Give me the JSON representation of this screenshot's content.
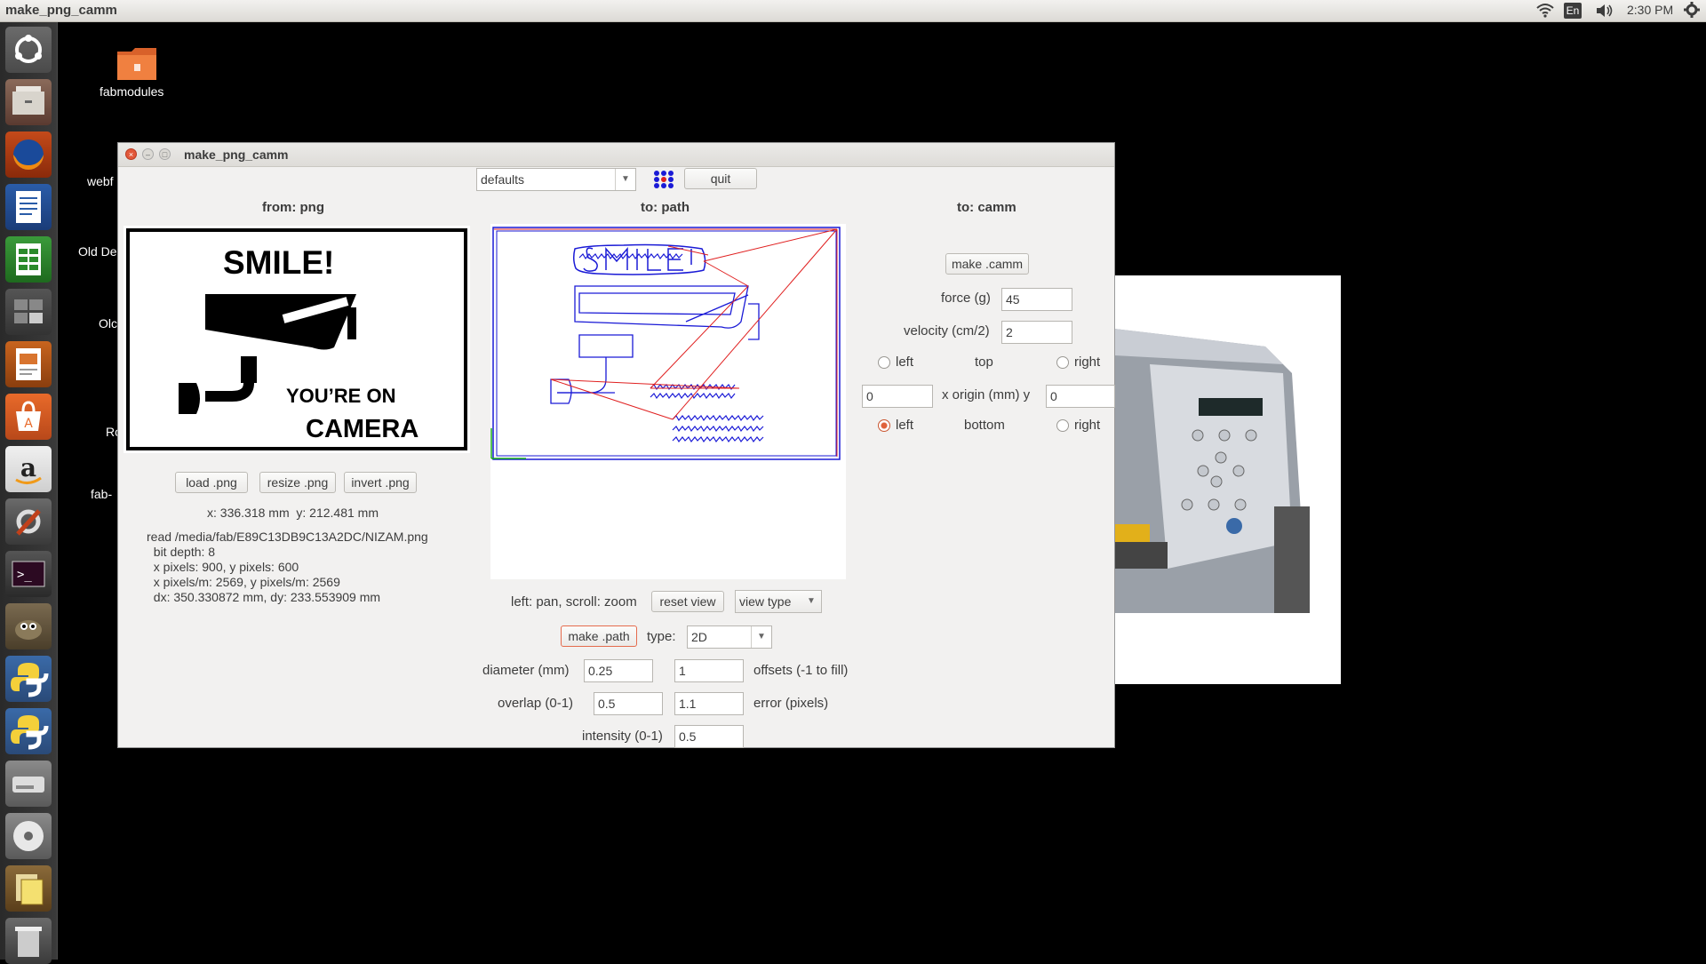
{
  "topbar": {
    "app_title": "make_png_camm",
    "keyboard_layout": "En",
    "clock": "2:30 PM",
    "icons": [
      "wifi-icon",
      "keyboard-icon",
      "volume-icon",
      "gear-icon"
    ]
  },
  "launcher": {
    "items": [
      "dash-icon",
      "files-icon",
      "firefox-icon",
      "writer-icon",
      "calc-icon",
      "workspace-switcher-icon",
      "impress-icon",
      "software-center-icon",
      "amazon-icon",
      "system-settings-icon",
      "terminal-icon",
      "gimp-icon",
      "python-icon",
      "python-icon",
      "disk-icon",
      "dvd-icon",
      "update-manager-icon",
      "trash-icon"
    ]
  },
  "desktop": {
    "icons": [
      {
        "label": "fabmodules"
      },
      {
        "label": "webf"
      },
      {
        "label": "Old De"
      },
      {
        "label": "Olc"
      },
      {
        "label": "Ro"
      },
      {
        "label": "fab-"
      }
    ]
  },
  "window": {
    "title": "make_png_camm",
    "defaults_combo": "defaults",
    "quit_label": "quit",
    "from_header": "from: png",
    "path_header": "to: path",
    "camm_header": "to: camm",
    "png_image": {
      "line1": "SMILE!",
      "line2": "YOU’RE ON",
      "line3": "CAMERA"
    },
    "load_png": "load .png",
    "resize_png": "resize .png",
    "invert_png": "invert .png",
    "coords": "x: 336.318 mm  y: 212.481 mm",
    "info_lines": [
      "read /media/fab/E89C13DB9C13A2DC/NIZAM.png",
      "  bit depth: 8",
      "  x pixels: 900, y pixels: 600",
      "  x pixels/m: 2569, y pixels/m: 2569",
      "  dx: 350.330872 mm, dy: 233.553909 mm"
    ],
    "pan_hint": "left: pan, scroll: zoom",
    "reset_view": "reset view",
    "view_type": "view type",
    "make_path": "make .path",
    "type_label": "type:",
    "type_value": "2D",
    "diameter_label": "diameter (mm)",
    "diameter_value": "0.25",
    "offsets_value": "1",
    "offsets_label": "offsets (-1 to fill)",
    "overlap_label": "overlap (0-1)",
    "overlap_value": "0.5",
    "error_value": "1.1",
    "error_label": "error (pixels)",
    "intensity_label": "intensity (0-1)",
    "intensity_value": "0.5",
    "make_camm": "make .camm",
    "force_label": "force (g)",
    "force_value": "45",
    "velocity_label": "velocity (cm/2)",
    "velocity_value": "2",
    "top_left": "left",
    "top_label": "top",
    "top_right": "right",
    "origin_x_value": "0",
    "origin_label": "x  origin (mm)  y",
    "origin_y_value": "0",
    "bottom_left": "left",
    "bottom_label": "bottom",
    "bottom_right": "right",
    "selected_origin": "bottom-left"
  },
  "colors": {
    "path_blue": "#1a1ad6",
    "path_red": "#e02020",
    "accent_orange": "#e56b4d"
  }
}
